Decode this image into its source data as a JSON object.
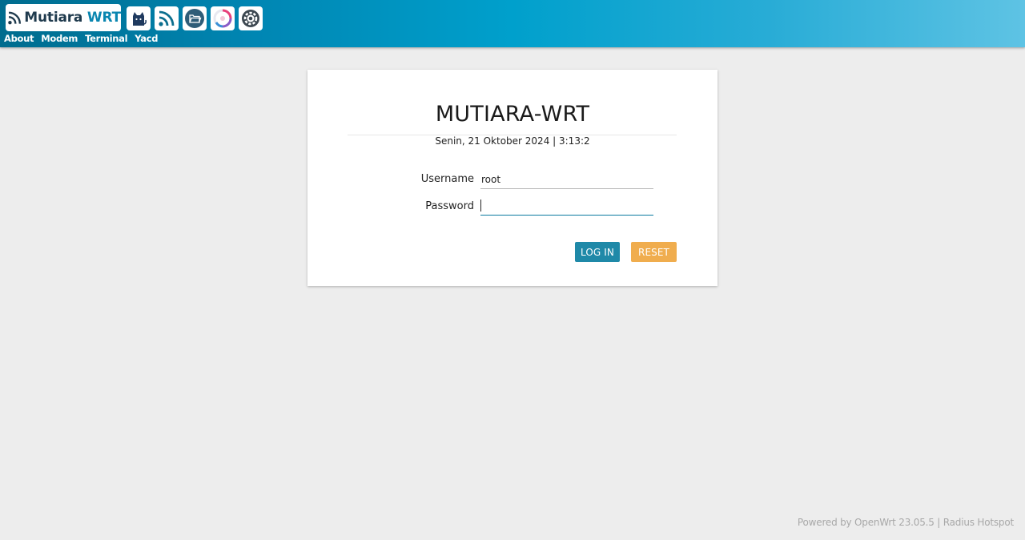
{
  "header": {
    "logo_text": "Mutiara",
    "logo_accent": "WRT",
    "apps": [
      {
        "icon": "openclash-cat-icon"
      },
      {
        "icon": "feed-icon"
      },
      {
        "icon": "file-manager-icon"
      },
      {
        "icon": "speedtest-icon"
      },
      {
        "icon": "settings-gear-icon"
      }
    ],
    "nav": [
      "About",
      "Modem",
      "Terminal",
      "Yacd"
    ]
  },
  "login": {
    "title": "MUTIARA-WRT",
    "datetime": "Senin, 21 Oktober 2024 | 3:13:2",
    "username_label": "Username",
    "username_value": "root",
    "password_label": "Password",
    "password_value": "",
    "login_label": "LOG IN",
    "reset_label": "RESET"
  },
  "footer": {
    "text": "Powered by OpenWrt 23.05.5 | Radius Hotspot"
  },
  "colors": {
    "header_start": "#006c8e",
    "header_end": "#5ec3e4",
    "login_button": "#1f89a8",
    "reset_button": "#f0ad4e"
  }
}
